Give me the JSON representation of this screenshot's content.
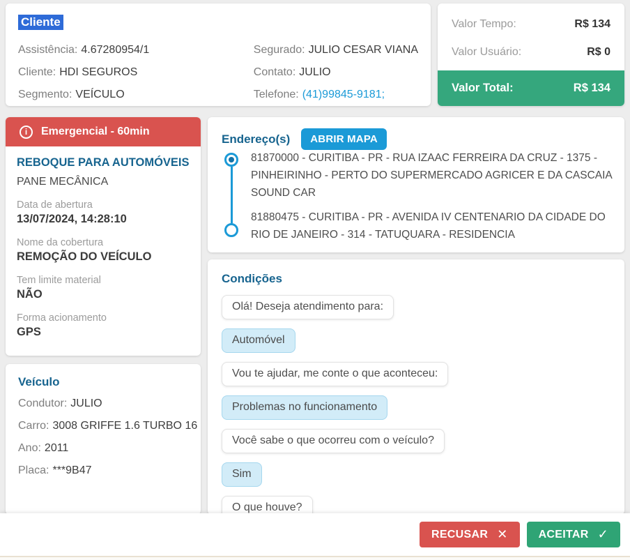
{
  "client": {
    "title": "Cliente",
    "left": [
      {
        "label": "Assistência:",
        "value": "4.67280954/1"
      },
      {
        "label": "Cliente:",
        "value": "HDI SEGUROS"
      },
      {
        "label": "Segmento:",
        "value": "VEÍCULO"
      }
    ],
    "right": [
      {
        "label": "Segurado:",
        "value": "JULIO CESAR VIANA"
      },
      {
        "label": "Contato:",
        "value": "JULIO"
      },
      {
        "label": "Telefone:",
        "value": "(41)99845-9181;"
      }
    ]
  },
  "valor": {
    "rows": [
      {
        "label": "Valor Tempo:",
        "value": "R$ 134"
      },
      {
        "label": "Valor Usuário:",
        "value": "R$ 0"
      }
    ],
    "total_label": "Valor Total:",
    "total_value": "R$ 134"
  },
  "service": {
    "banner": "Emergencial - 60min",
    "title": "REBOQUE PARA AUTOMÓVEIS",
    "subtitle": "PANE MECÂNICA",
    "fields": [
      {
        "label": "Data de abertura",
        "value": "13/07/2024, 14:28:10"
      },
      {
        "label": "Nome da cobertura",
        "value": "REMOÇÃO DO VEÍCULO"
      },
      {
        "label": "Tem limite material",
        "value": "NÃO"
      },
      {
        "label": "Forma acionamento",
        "value": "GPS"
      }
    ]
  },
  "vehicle": {
    "title": "Veículo",
    "fields": [
      {
        "label": "Condutor:",
        "value": "JULIO"
      },
      {
        "label": "Carro:",
        "value": "3008 GRIFFE 1.6 TURBO 16"
      },
      {
        "label": "Ano:",
        "value": "2011"
      },
      {
        "label": "Placa:",
        "value": "***9B47"
      }
    ]
  },
  "addresses": {
    "title": "Endereço(s)",
    "map_button": "ABRIR MAPA",
    "items": [
      {
        "text": "81870000 - CURITIBA - PR - RUA IZAAC FERREIRA DA CRUZ - 1375 - PINHEIRINHO - PERTO DO SUPERMERCADO AGRICER E DA CASCAIA SOUND CAR",
        "selected": true
      },
      {
        "text": "81880475 - CURITIBA - PR - AVENIDA IV CENTENARIO DA CIDADE DO RIO DE JANEIRO - 314 - TATUQUARA - RESIDENCIA",
        "selected": false
      }
    ]
  },
  "conditions": {
    "title": "Condições",
    "messages": [
      {
        "from": "bot",
        "text": "Olá! Deseja atendimento para:"
      },
      {
        "from": "user",
        "text": "Automóvel"
      },
      {
        "from": "bot",
        "text": "Vou te ajudar, me conte o que aconteceu:"
      },
      {
        "from": "user",
        "text": "Problemas no funcionamento"
      },
      {
        "from": "bot",
        "text": "Você sabe o que ocorreu com o veículo?"
      },
      {
        "from": "user",
        "text": "Sim"
      },
      {
        "from": "bot",
        "text": "O que houve?"
      }
    ]
  },
  "actions": {
    "reject": "RECUSAR",
    "accept": "ACEITAR"
  },
  "icons": {
    "info": "i",
    "close": "✕",
    "check": "✓"
  },
  "colors": {
    "accent_blue": "#1b9ad7",
    "heading_blue": "#17648f",
    "selection_blue": "#2e6bd8",
    "banner_red": "#d9534f",
    "total_green": "#35a77d",
    "accept_green": "#2fa475",
    "user_bubble_blue": "#d2ecf8"
  }
}
